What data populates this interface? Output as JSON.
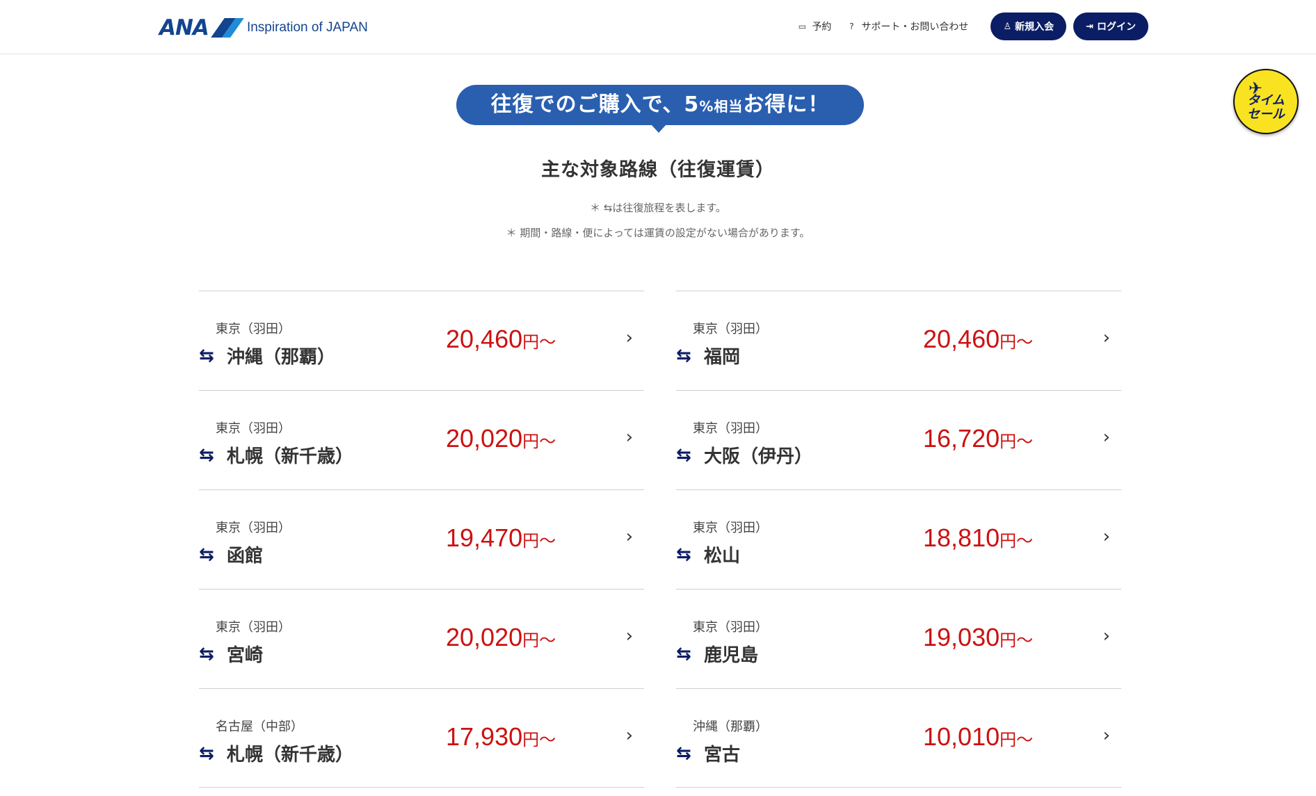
{
  "header": {
    "logo_text": "ANA",
    "tagline": "Inspiration of JAPAN",
    "nav": {
      "reserve": "予約",
      "support": "サポート・お問い合わせ",
      "signup": "新規入会",
      "login": "ログイン"
    }
  },
  "timesale": {
    "label_line1": "タイム",
    "label_line2": "セール"
  },
  "banner": {
    "part1": "往復でのご購入で、5",
    "percent": "%相当",
    "part2": "お得に！"
  },
  "section_title": "主な対象路線（往復運賃）",
  "notes": {
    "note1": "＊ ⇆は往復旅程を表します。",
    "note2": "＊ 期間・路線・便によっては運賃の設定がない場合があります。"
  },
  "yen_suffix": "円〜",
  "routes_left": [
    {
      "origin": "東京（羽田）",
      "destination": "沖縄（那覇）",
      "price": "20,460"
    },
    {
      "origin": "東京（羽田）",
      "destination": "札幌（新千歳）",
      "price": "20,020"
    },
    {
      "origin": "東京（羽田）",
      "destination": "函館",
      "price": "19,470"
    },
    {
      "origin": "東京（羽田）",
      "destination": "宮崎",
      "price": "20,020"
    },
    {
      "origin": "名古屋（中部）",
      "destination": "札幌（新千歳）",
      "price": "17,930"
    }
  ],
  "routes_right": [
    {
      "origin": "東京（羽田）",
      "destination": "福岡",
      "price": "20,460"
    },
    {
      "origin": "東京（羽田）",
      "destination": "大阪（伊丹）",
      "price": "16,720"
    },
    {
      "origin": "東京（羽田）",
      "destination": "松山",
      "price": "18,810"
    },
    {
      "origin": "東京（羽田）",
      "destination": "鹿児島",
      "price": "19,030"
    },
    {
      "origin": "沖縄（那覇）",
      "destination": "宮古",
      "price": "10,010"
    }
  ],
  "colors": {
    "navy": "#0b1d64",
    "banner_blue": "#2a5fb0",
    "price_red": "#cc1111",
    "badge_yellow": "#f9e320"
  },
  "icons": {
    "roundtrip": "roundtrip-arrows-icon",
    "chevron": "chevron-right-icon"
  }
}
